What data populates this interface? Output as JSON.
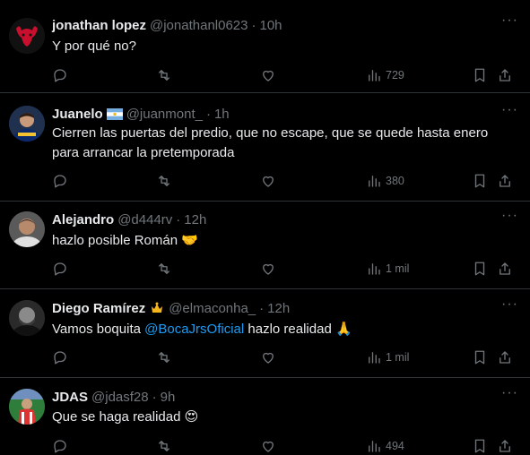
{
  "tweets": [
    {
      "name": "jonathan lopez",
      "handle": "@jonathanl0623",
      "time": "10h",
      "text": "Y por qué no?",
      "views": "729"
    },
    {
      "name": "Juanelo",
      "handle": "@juanmont_",
      "time": "1h",
      "text": "Cierren las puertas del predio, que no escape, que se quede hasta enero",
      "text2": "para arrancar la pretemporada",
      "views": "380"
    },
    {
      "name": "Alejandro",
      "handle": "@d444rv",
      "time": "12h",
      "text": "hazlo posible Román",
      "emoji": "🤝",
      "views": "1 mil"
    },
    {
      "name": "Diego Ramírez",
      "handle": "@elmaconha_",
      "time": "12h",
      "text_pre": "Vamos boquita ",
      "mention": "@BocaJrsOficial",
      "text_post": " hazlo realidad",
      "emoji": "🙏",
      "views": "1 mil"
    },
    {
      "name": "JDAS",
      "handle": "@jdasf28",
      "time": "9h",
      "text": "Que se haga realidad",
      "emoji": "😍",
      "views": "494"
    }
  ],
  "icons": {
    "reply": "reply-icon",
    "retweet": "retweet-icon",
    "like": "like-icon",
    "views": "views-icon",
    "bookmark": "bookmark-icon",
    "share": "share-icon",
    "more": "more-icon"
  }
}
